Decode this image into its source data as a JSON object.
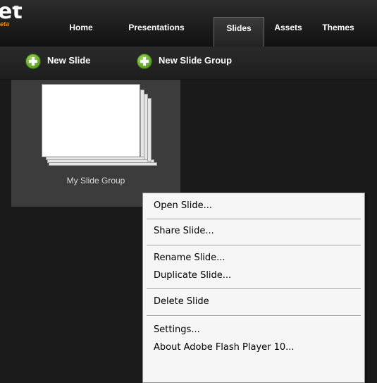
{
  "logo": {
    "main": "et",
    "tm": "™",
    "sub": "eta"
  },
  "nav": {
    "tabs": [
      {
        "label": "Home"
      },
      {
        "label": "Presentations"
      },
      {
        "label": "Slides",
        "active": true
      },
      {
        "label": "Assets"
      },
      {
        "label": "Themes"
      }
    ]
  },
  "toolbar": {
    "new_slide": "New Slide",
    "new_slide_group": "New Slide Group",
    "icon": "plus-circle-icon",
    "icon_color": "#5c9e25"
  },
  "slide_group": {
    "label": "My Slide Group"
  },
  "context_menu": {
    "items": [
      "Open Slide...",
      "Share Slide...",
      "Rename Slide...",
      "Duplicate Slide...",
      "Delete Slide",
      "Settings...",
      "About Adobe Flash Player 10..."
    ]
  },
  "colors": {
    "background": "#1b1b1b",
    "panel": "#3c3c3c",
    "logo_accent": "#f08a1c",
    "menu_bg": "#f6f6f6"
  }
}
